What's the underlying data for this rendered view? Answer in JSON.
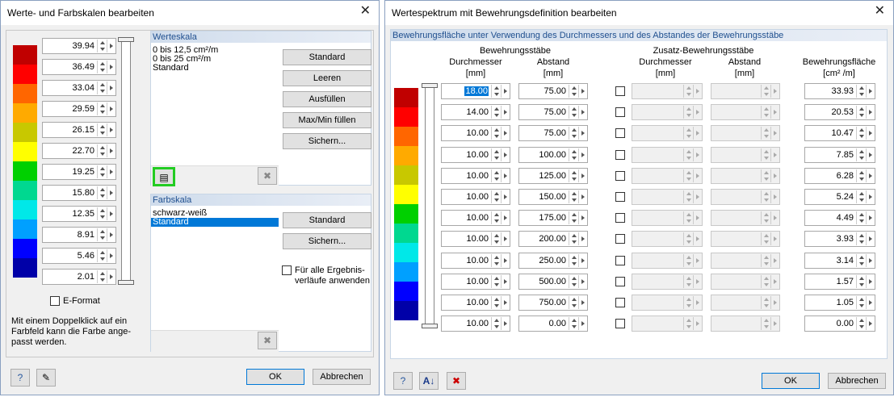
{
  "left_dialog": {
    "title": "Werte- und Farbskalen bearbeiten",
    "scale_values": [
      "39.94",
      "36.49",
      "33.04",
      "29.59",
      "26.15",
      "22.70",
      "19.25",
      "15.80",
      "12.35",
      "8.91",
      "5.46",
      "2.01"
    ],
    "colors": [
      "#c00000",
      "#ff0000",
      "#ff6600",
      "#ffaa00",
      "#c8c800",
      "#ffff00",
      "#00d000",
      "#00d890",
      "#00e8e8",
      "#00a0ff",
      "#0000ff",
      "#0000a8"
    ],
    "eformat_label": "E-Format",
    "hint_text": "Mit einem Doppelklick auf ein Farbfeld kann die Farbe ange-passt werden.",
    "werteskala": {
      "title": "Werteskala",
      "items": [
        "0 bis 12,5 cm²/m",
        "0 bis 25 cm²/m",
        "Standard"
      ],
      "buttons": {
        "standard": "Standard",
        "leeren": "Leeren",
        "ausfuellen": "Ausfüllen",
        "maxmin": "Max/Min füllen",
        "sichern": "Sichern..."
      }
    },
    "farbskala": {
      "title": "Farbskala",
      "items": [
        "schwarz-weiß",
        "Standard"
      ],
      "selected_index": 1,
      "buttons": {
        "standard": "Standard",
        "sichern": "Sichern..."
      },
      "checkbox_label": "Für alle Ergebnis-verläufe anwenden"
    },
    "ok_label": "OK",
    "cancel_label": "Abbrechen"
  },
  "right_dialog": {
    "title": "Wertespektrum mit Bewehrungsdefinition bearbeiten",
    "section_title": "Bewehrungsfläche unter Verwendung des Durchmessers und des Abstandes der Bewehrungsstäbe",
    "headers": {
      "bewehrungsstaebe": "Bewehrungsstäbe",
      "zusatz": "Zusatz-Bewehrungsstäbe",
      "durchmesser": "Durchmesser",
      "abstand": "Abstand",
      "unit_mm": "[mm]",
      "flaeche": "Bewehrungsfläche",
      "flaeche_unit": "[cm² /m]"
    },
    "rows": [
      {
        "d": "18.00",
        "a": "75.00",
        "area": "33.93"
      },
      {
        "d": "14.00",
        "a": "75.00",
        "area": "20.53"
      },
      {
        "d": "10.00",
        "a": "75.00",
        "area": "10.47"
      },
      {
        "d": "10.00",
        "a": "100.00",
        "area": "7.85"
      },
      {
        "d": "10.00",
        "a": "125.00",
        "area": "6.28"
      },
      {
        "d": "10.00",
        "a": "150.00",
        "area": "5.24"
      },
      {
        "d": "10.00",
        "a": "175.00",
        "area": "4.49"
      },
      {
        "d": "10.00",
        "a": "200.00",
        "area": "3.93"
      },
      {
        "d": "10.00",
        "a": "250.00",
        "area": "3.14"
      },
      {
        "d": "10.00",
        "a": "500.00",
        "area": "1.57"
      },
      {
        "d": "10.00",
        "a": "750.00",
        "area": "1.05"
      },
      {
        "d": "10.00",
        "a": "0.00",
        "area": "0.00"
      }
    ],
    "colors": [
      "#c00000",
      "#ff0000",
      "#ff6600",
      "#ffaa00",
      "#c8c800",
      "#ffff00",
      "#00d000",
      "#00d890",
      "#00e8e8",
      "#00a0ff",
      "#0000ff",
      "#0000a8"
    ],
    "ok_label": "OK",
    "cancel_label": "Abbrechen"
  }
}
